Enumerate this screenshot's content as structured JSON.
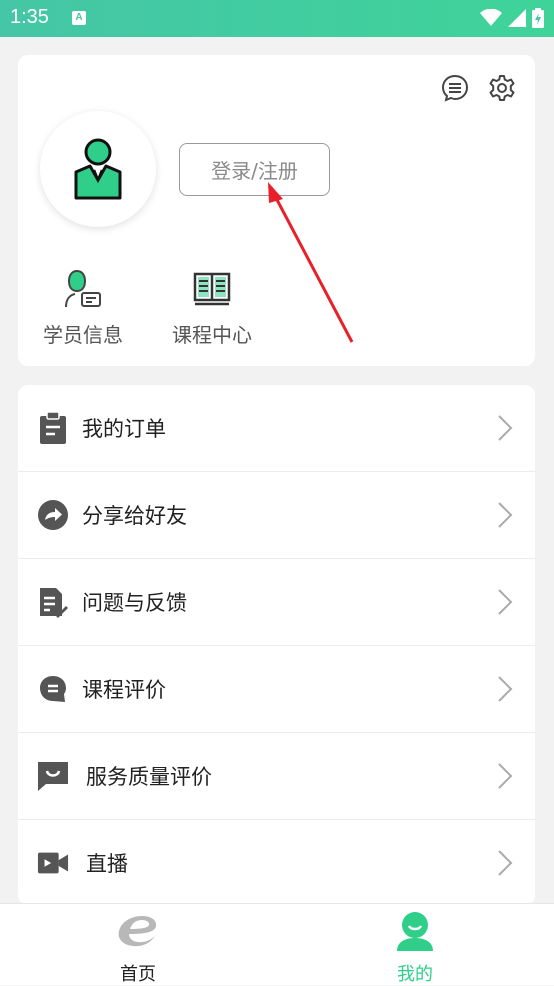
{
  "status_bar": {
    "time": "1:35",
    "notification_icon": "A"
  },
  "profile": {
    "login_label": "登录/注册",
    "quick_links": [
      {
        "label": "学员信息",
        "icon": "student-info-icon"
      },
      {
        "label": "课程中心",
        "icon": "book-icon"
      }
    ]
  },
  "menu": [
    {
      "label": "我的订单",
      "icon": "clipboard-icon"
    },
    {
      "label": "分享给好友",
      "icon": "share-icon"
    },
    {
      "label": "问题与反馈",
      "icon": "feedback-icon"
    },
    {
      "label": "课程评价",
      "icon": "comment-icon"
    },
    {
      "label": "服务质量评价",
      "icon": "smile-message-icon"
    },
    {
      "label": "直播",
      "icon": "video-icon"
    }
  ],
  "tabs": [
    {
      "label": "首页",
      "icon": "home-e-icon",
      "active": false
    },
    {
      "label": "我的",
      "icon": "user-icon",
      "active": true
    }
  ],
  "colors": {
    "accent": "#2fcf8a",
    "status_bar": "#45c6a6",
    "annotation": "#e8202a"
  }
}
